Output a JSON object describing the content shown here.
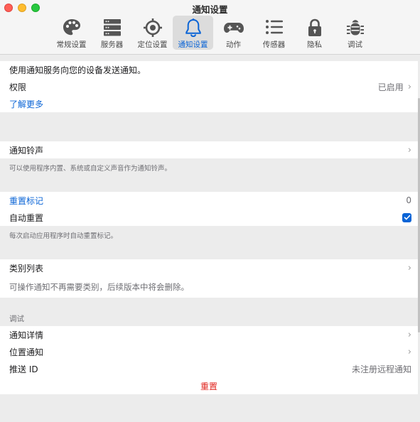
{
  "window": {
    "title": "通知设置"
  },
  "toolbar": [
    {
      "label": "常规设置",
      "icon": "palette-icon"
    },
    {
      "label": "服务器",
      "icon": "server-icon"
    },
    {
      "label": "定位设置",
      "icon": "location-target-icon"
    },
    {
      "label": "通知设置",
      "icon": "bell-icon",
      "active": true
    },
    {
      "label": "动作",
      "icon": "gamepad-icon"
    },
    {
      "label": "传感器",
      "icon": "list-icon"
    },
    {
      "label": "隐私",
      "icon": "lock-icon"
    },
    {
      "label": "调试",
      "icon": "bug-icon"
    }
  ],
  "permissions": {
    "description": "使用通知服务向您的设备发送通知。",
    "label": "权限",
    "value": "已启用",
    "learn_more": "了解更多"
  },
  "ringtone": {
    "label": "通知铃声",
    "note": "可以使用程序内置、系统或自定义声音作为通知铃声。"
  },
  "badge": {
    "reset_label": "重置标记",
    "reset_value": "0",
    "auto_reset_label": "自动重置",
    "auto_reset_checked": true,
    "note": "每次启动应用程序时自动重置标记。"
  },
  "categories": {
    "label": "类别列表",
    "note": "可操作通知不再需要类别，后续版本中将会删除。"
  },
  "debug": {
    "header": "调试",
    "details_label": "通知详情",
    "location_label": "位置通知",
    "push_id_label": "推送 ID",
    "push_id_value": "未注册远程通知",
    "reset_label": "重置"
  },
  "colors": {
    "accent": "#0a64d6",
    "destructive": "#e0241e"
  }
}
